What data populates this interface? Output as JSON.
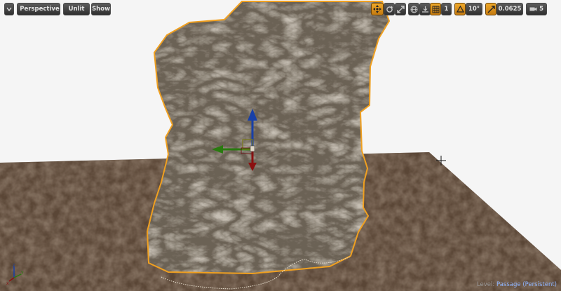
{
  "toolbar_left": {
    "perspective_label": "Perspective",
    "unlit_label": "Unlit",
    "show_label": "Show"
  },
  "toolbar_right": {
    "camera_speed_value": "1",
    "rotation_snap_value": "10°",
    "scale_snap_value": "0.0625",
    "camera_speed_level": "5"
  },
  "status": {
    "level_label": "Level:",
    "level_name": "Passage (Persistent)"
  },
  "colors": {
    "selection_outline": "#f0a020",
    "toolbar_active": "#e8961e",
    "gizmo_x": "#8b1010",
    "gizmo_y": "#2a7a10",
    "gizmo_z": "#1840a8"
  }
}
